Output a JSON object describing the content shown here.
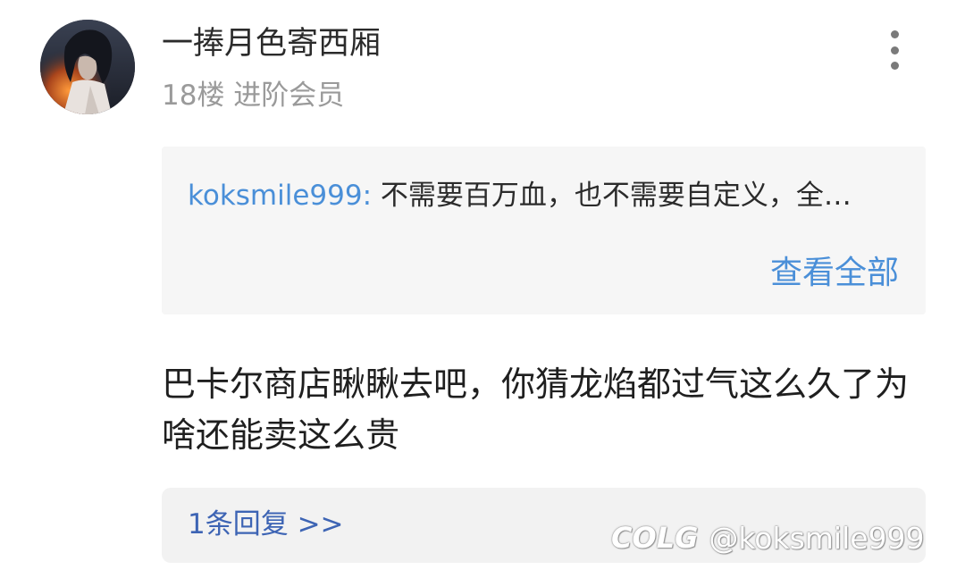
{
  "post": {
    "username": "一捧月色寄西厢",
    "floor_and_level": "18楼 进阶会员",
    "quote": {
      "author": "koksmile999:",
      "text": "不需要百万血，也不需要自定义，全…",
      "view_all_label": "查看全部"
    },
    "content": "巴卡尔商店瞅瞅去吧，你猜龙焰都过气这么久了为啥还能卖这么贵",
    "reply_link_label": "1条回复 >>"
  },
  "watermark": {
    "logo_text": "COLG",
    "handle": "@koksmile999"
  },
  "icons": {
    "avatar": "avatar-image",
    "more": "more-vertical-icon"
  },
  "colors": {
    "link_blue": "#4a8fd8",
    "reply_blue": "#3d64b4",
    "meta_gray": "#9a9a9a",
    "quote_bg": "#f6f6f6",
    "reply_bg": "#f2f2f2"
  }
}
